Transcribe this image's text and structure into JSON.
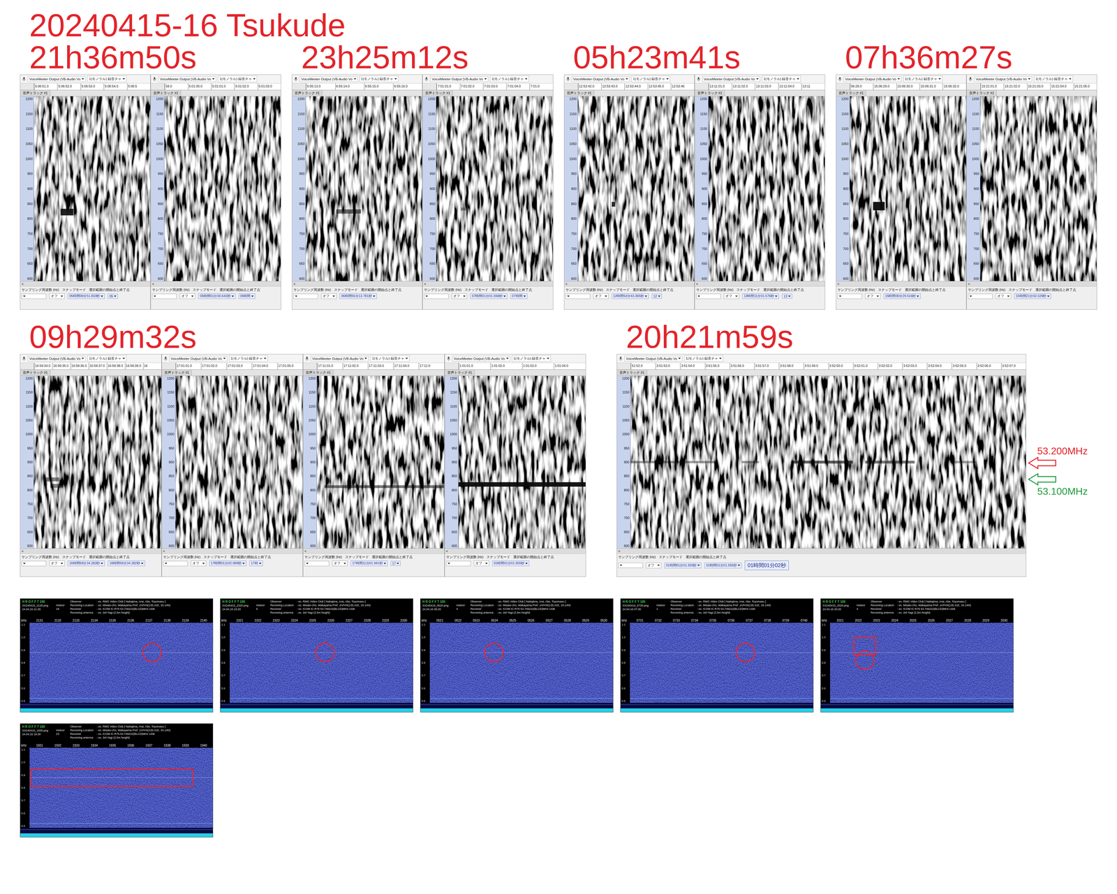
{
  "title": "20240415-16  Tsukude",
  "audacity": {
    "device": "VoiceMeeter Output (VB-Audio Vo",
    "channel": "1(モノラル) 録音チャ",
    "track": "音声トラック #1",
    "rate_label": "サンプリング周波数 (Hz)",
    "snap_label": "スナップモード",
    "selection_label": "選択範囲の開始点と終了点",
    "snap_value": "オフ",
    "scroll_left": "<",
    "hz_ticks": [
      "1200",
      "1150",
      "1100",
      "1050",
      "1000",
      "950",
      "900",
      "850",
      "800",
      "750",
      "700",
      "650",
      "600"
    ]
  },
  "rows": [
    {
      "groups": [
        {
          "time": "21h36m50s",
          "panels": [
            {
              "ticks": [
                "5:06:51.0",
                "5:06:52.0",
                "5:06:53.0",
                "5:06:54.0",
                "5:06:5"
              ],
              "selection": [
                "05時間06分51.833秒",
                "05"
              ],
              "marks": [
                {
                  "from": 1.15,
                  "to": 1.7,
                  "hz": 822,
                  "band": 22,
                  "strength": 0.9
                }
              ],
              "pings": [
                1.05
              ]
            },
            {
              "ticks": [
                "59.0",
                "5:01:00.0",
                "5:01:01.0",
                "5:01:02.0",
                "5:01:03.0"
              ],
              "selection": [
                "05時間01分00.643秒",
                "05時間"
              ],
              "marks": [],
              "pings": []
            }
          ]
        },
        {
          "time": "23h25m12s",
          "panels": [
            {
              "ticks": [
                "6:55:13.0",
                "6:55:14.0",
                "6:55:15.0",
                "6:55:16.0"
              ],
              "selection": [
                "06時間55分13.781秒"
              ],
              "marks": [
                {
                  "from": 1.05,
                  "to": 1.9,
                  "hz": 824,
                  "band": 14,
                  "strength": 0.6
                }
              ],
              "pings": [
                1.0
              ]
            },
            {
              "ticks": [
                "7:01:01.0",
                "7:01:02.0",
                "7:01:03.0",
                "7:01:04.0",
                "7:01:0"
              ],
              "selection": [
                "07時間01分01.558秒",
                "07時間"
              ],
              "marks": [
                {
                  "from": 1.05,
                  "to": 1.3,
                  "hz": 832,
                  "band": 10,
                  "strength": 0.35
                }
              ],
              "pings": [
                0.1
              ]
            }
          ]
        },
        {
          "time": "05h23m41s",
          "panels": [
            {
              "ticks": [
                "12:53:42.0",
                "12:53:43.0",
                "12:53:44.0",
                "12:53:45.0",
                "12:53:46"
              ],
              "selection": [
                "12時間53分43.365秒",
                "12"
              ],
              "marks": [
                {
                  "from": 1.45,
                  "to": 1.6,
                  "hz": 848,
                  "band": 16,
                  "strength": 0.85
                }
              ],
              "pings": [
                1.4
              ]
            },
            {
              "ticks": [
                "13:11:01.0",
                "13:11:02.0",
                "13:11:03.0",
                "13:11:04.0",
                "13:11"
              ],
              "selection": [
                "13時間11分01.576秒",
                "13"
              ],
              "marks": [],
              "pings": [
                0.2
              ]
            }
          ]
        },
        {
          "time": "07h36m27s",
          "panels": [
            {
              "ticks": [
                "06:28.0",
                "15:06:29.0",
                "15:06:30.0",
                "15:06:31.0",
                "15:06:32.0"
              ],
              "selection": [
                "15時間06分29.516秒"
              ],
              "marks": [
                {
                  "from": 1.0,
                  "to": 1.5,
                  "hz": 842,
                  "band": 28,
                  "strength": 0.95
                }
              ],
              "pings": [
                0.95
              ]
            },
            {
              "ticks": [
                "15:21:01.0",
                "15:21:02.0",
                "15:21:03.0",
                "15:21:04.0",
                "15:21:05.0"
              ],
              "selection": [
                "15時間21分02.029秒"
              ],
              "marks": [],
              "pings": []
            }
          ]
        }
      ]
    },
    {
      "groups": [
        {
          "time": "09h29m32s",
          "panels": [
            {
              "ticks": [
                "16:59:34.0",
                "16:59:35.0",
                "16:59:36.0",
                "16:59:37.0",
                "16:59:38.0",
                "16:59:39.0",
                "16"
              ],
              "selection": [
                "16時間59分34.282秒",
                "16時間59分34.282秒"
              ],
              "marks": [
                {
                  "from": 0.6,
                  "to": 1.4,
                  "hz": 838,
                  "band": 14,
                  "strength": 0.5
                },
                {
                  "from": 0.9,
                  "to": 1.6,
                  "hz": 815,
                  "band": 14,
                  "strength": 0.5
                }
              ],
              "pings": []
            },
            {
              "ticks": [
                "17:01:01.0",
                "17:01:02.0",
                "17:01:03.0",
                "17:01:04.0",
                "17:01:05.0"
              ],
              "selection": [
                "17時間01分02.089秒",
                "17時"
              ],
              "marks": [],
              "pings": []
            },
            {
              "ticks": [
                "17:11:01.0",
                "17:11:02.0",
                "17:11:03.0",
                "17:11:04.0",
                "17:11:0"
              ],
              "selection": [
                "17時間11分01.941秒",
                "17"
              ],
              "marks": [
                {
                  "from": 0.3,
                  "to": 5,
                  "hz": 812,
                  "band": 10,
                  "strength": 0.55
                }
              ],
              "pings": [
                0.3
              ]
            },
            {
              "ticks": [
                "1:01:01.0",
                "1:01:02.0",
                "1:01:03.0",
                "1:01:04.0"
              ],
              "selection": [
                "01時間01分01.555秒"
              ],
              "marks": [
                {
                  "from": 0.0,
                  "to": 4,
                  "hz": 820,
                  "band": 16,
                  "strength": 0.95
                }
              ],
              "pings": [
                0.0
              ]
            }
          ]
        },
        {
          "time": "20h21m59s",
          "panels": [
            {
              "ticks": [
                "51:52.0",
                "3:51:53.0",
                "3:51:54.0",
                "3:51:55.0",
                "3:51:56.0",
                "3:51:57.0",
                "3:51:58.0",
                "3:51:59.0",
                "3:52:00.0",
                "3:52:01.0",
                "3:52:02.0",
                "3:52:03.0",
                "3:52:04.0",
                "3:52:05.0",
                "3:52:06.0",
                "3:52:07.0"
              ],
              "selection": [
                "01時間01分01.555秒",
                "01時間01分01.555秒"
              ],
              "big": "01時間01分02秒",
              "marks": [
                {
                  "from": 0.0,
                  "to": 3.5,
                  "hz": 900,
                  "band": 8,
                  "strength": 0.4
                },
                {
                  "from": 4.5,
                  "to": 5.2,
                  "hz": 900,
                  "band": 8,
                  "strength": 0.4
                },
                {
                  "from": 6.5,
                  "to": 9.0,
                  "hz": 900,
                  "band": 10,
                  "strength": 0.65
                },
                {
                  "from": 9.5,
                  "to": 11.5,
                  "hz": 900,
                  "band": 10,
                  "strength": 0.55
                },
                {
                  "from": 13,
                  "to": 14,
                  "hz": 900,
                  "band": 8,
                  "strength": 0.35
                }
              ],
              "pings": []
            }
          ],
          "markers": [
            {
              "label": "53.200MHz",
              "color": "#e3242b",
              "hz": 900
            },
            {
              "label": "53.100MHz",
              "color": "#1f9d3f",
              "hz": 842
            }
          ]
        }
      ]
    }
  ],
  "hrofft": {
    "title": "H R O F F T 100",
    "meteor_label": "meteor",
    "y_unit": "kHz",
    "y_ticks": [
      "1.1",
      "1.0",
      "0.9",
      "0.8",
      "0.7",
      "0.6",
      "0.5"
    ],
    "lines": [
      {
        "label": "Observer",
        "value": ": ex. RMG Video Club [ Nakajima, Arai, Abe, Toyomasu ]"
      },
      {
        "label": "Receiving Location",
        "value": ": ex. Misato-cho, Wakayama-Pref. JAPAN(135.41E, 34.14N)"
      },
      {
        "label": "Receiver",
        "value": ": ex. ICOM IC-R75 53.749222(BLCD)MHz USB"
      },
      {
        "label": "Receiving antenna",
        "value": ": ex. 2el-Yagi (2.5m height)"
      }
    ],
    "shots": [
      {
        "file": "XX240415_2130.png",
        "count": "18",
        "date": "24.04.15 21:30",
        "ticks": [
          "2131",
          "2132",
          "2133",
          "2134",
          "2135",
          "2136",
          "2137",
          "2138",
          "2139",
          "2140"
        ],
        "annotations": [
          {
            "kind": "circle",
            "t": 6.2,
            "khz": 0.88
          }
        ]
      },
      {
        "file": "XX240415_2320.png",
        "count": "6",
        "date": "24.04.15 23:20",
        "ticks": [
          "2321",
          "2322",
          "2323",
          "2324",
          "2325",
          "2326",
          "2327",
          "2328",
          "2329",
          "2330"
        ],
        "annotations": [
          {
            "kind": "circle",
            "t": 4.7,
            "khz": 0.88
          }
        ]
      },
      {
        "file": "XX240416_0520.png",
        "count": "4",
        "date": "24.04.16 05:20",
        "ticks": [
          "0521",
          "0522",
          "0523",
          "0524",
          "0525",
          "0526",
          "0527",
          "0528",
          "0529",
          "0530"
        ],
        "annotations": [
          {
            "kind": "circle",
            "t": 3.0,
            "khz": 0.88
          }
        ]
      },
      {
        "file": "XX240416_0730.png",
        "count": "1",
        "date": "24.04.16 07:30",
        "ticks": [
          "0731",
          "0732",
          "0733",
          "0734",
          "0735",
          "0736",
          "0737",
          "0738",
          "0739",
          "0740"
        ],
        "annotations": [
          {
            "kind": "circle",
            "t": 5.8,
            "khz": 0.88
          }
        ]
      },
      {
        "file": "XX240415_2020.png",
        "count": "4",
        "date": "24.04.15 20:20",
        "ticks": [
          "2021",
          "2022",
          "2023",
          "2024",
          "2025",
          "2026",
          "2027",
          "2028",
          "2029",
          "2030"
        ],
        "annotations": [
          {
            "kind": "rect",
            "from": 0.8,
            "to": 2.0,
            "khz": 0.93
          },
          {
            "kind": "circle",
            "t": 1.4,
            "khz": 0.82
          }
        ]
      },
      {
        "file": "XX240415_1930.png",
        "count": "23",
        "date": "24.04.15 19:30",
        "ticks": [
          "1931",
          "1932",
          "1933",
          "1934",
          "1935",
          "1936",
          "1937",
          "1938",
          "1939",
          "1940"
        ],
        "annotations": [
          {
            "kind": "rect",
            "from": -0.45,
            "to": 8.4,
            "khz": 0.88
          }
        ]
      }
    ]
  }
}
